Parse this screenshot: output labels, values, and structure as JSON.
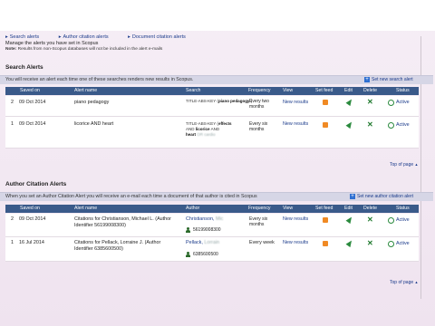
{
  "nav": {
    "search_alerts": "Search alerts",
    "author_citation_alerts": "Author citation alerts",
    "document_citation_alerts": "Document citation alerts"
  },
  "manage_text": "Manage the alerts you have set in Scopus",
  "note_label": "Note:",
  "note_text": "Results from non-Scopus databases will not be included in the alert e-mails",
  "search_section": {
    "title": "Search Alerts",
    "info": "You will receive an alert each time one of these searches renders new results in Scopus.",
    "new_link": "Set new search alert",
    "headers": [
      "Saved on",
      "Alert name",
      "Search",
      "Frequency",
      "View",
      "Set feed",
      "Edit",
      "Delete",
      "Status"
    ],
    "rows": [
      {
        "num": "2",
        "saved_on": "09 Oct 2014",
        "name": "piano pedagogy",
        "query_prefix": "TITLE-ABS-KEY (",
        "query_bold": "piano pedagogy",
        "query_suffix": ")",
        "frequency": "Every two months",
        "view": "New results",
        "status": "Active"
      },
      {
        "num": "1",
        "saved_on": "09 Oct 2014",
        "name": "licorice AND heart",
        "query_prefix": "TITLE-ABS-KEY (",
        "query_bold": "effects",
        "query_line2_a": "AND",
        "query_line2_bold": "licorice",
        "query_line2_b": "AND",
        "query_line3_bold": "heart",
        "query_line3_rest": "OR cardio",
        "frequency": "Every six months",
        "view": "New results",
        "status": "Active"
      }
    ],
    "top_of_page": "Top of page"
  },
  "author_section": {
    "title": "Author Citation Alerts",
    "info": "When you set an Author Citation Alert you will receive an e-mail each time a document of that author is cited in Scopus",
    "new_link": "Set new author citation alert",
    "headers": [
      "Saved on",
      "Alert name",
      "Author",
      "Frequency",
      "View",
      "Set feed",
      "Edit",
      "Delete",
      "Status"
    ],
    "rows": [
      {
        "num": "2",
        "saved_on": "09 Oct 2014",
        "name": "Citations for Christianson, Michael L. (Author Identifier 56199008300)",
        "name_line1": "Citations for Christianson, Michael L. (Author",
        "name_line2": "Identifier 56199008300)",
        "author": "Christianson,",
        "author_blur": "Mic",
        "author_id": "56199008300",
        "frequency": "Every six months",
        "view": "New results",
        "status": "Active"
      },
      {
        "num": "1",
        "saved_on": "16 Jul 2014",
        "name": "Citations for Pellack, Lorraine J. (Author Identifier 6385600500)",
        "name_line1": "Citations for Pellack, Lorraine J. (Author",
        "name_line2": "Identifier 6385600500)",
        "author": "Pellack,",
        "author_blur": "Lorrain",
        "author_id": "6385600500",
        "frequency": "Every week",
        "view": "New results",
        "status": "Active"
      }
    ],
    "top_of_page": "Top of page"
  },
  "colors": {
    "header_band": "#3a5a8a",
    "link": "#1a3a8a",
    "active": "#2b8a3e",
    "rss": "#f08a24"
  },
  "icons": [
    "rss-icon",
    "edit-pencil-icon",
    "delete-x-icon",
    "power-icon",
    "person-icon",
    "plus-icon"
  ]
}
